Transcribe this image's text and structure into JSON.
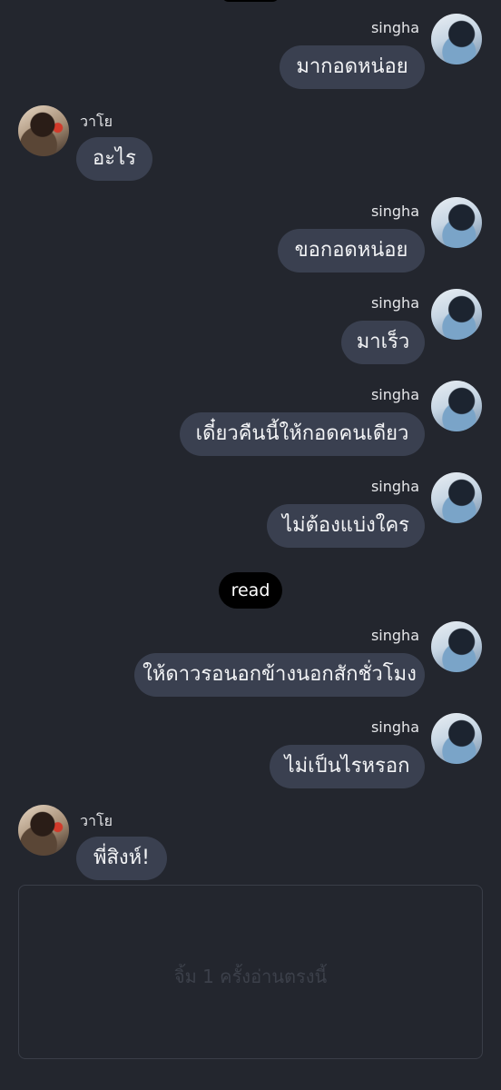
{
  "messages": [
    {
      "sender": "singha",
      "text": "มากอดหน่อย"
    },
    {
      "sender": "วาโย",
      "text": "อะไร"
    },
    {
      "sender": "singha",
      "text": "ขอกอดหน่อย"
    },
    {
      "sender": "singha",
      "text": "มาเร็ว"
    },
    {
      "sender": "singha",
      "text": "เดี๋ยวคืนนี้ให้กอดคนเดียว"
    },
    {
      "sender": "singha",
      "text": "ไม่ต้องแบ่งใคร"
    },
    {
      "sender": "singha",
      "text": "ให้ดาวรอนอกข้างนอกสักชั่วโมง"
    },
    {
      "sender": "singha",
      "text": "ไม่เป็นไรหรอก"
    },
    {
      "sender": "วาโย",
      "text": "พี่สิงห์!"
    }
  ],
  "read_label": "read",
  "footer_text": "จิ้ม 1 ครั้งอ่านตรงนี้",
  "colors": {
    "background": "#23262e",
    "bubble": "#3a4050",
    "read_badge": "#000000"
  }
}
